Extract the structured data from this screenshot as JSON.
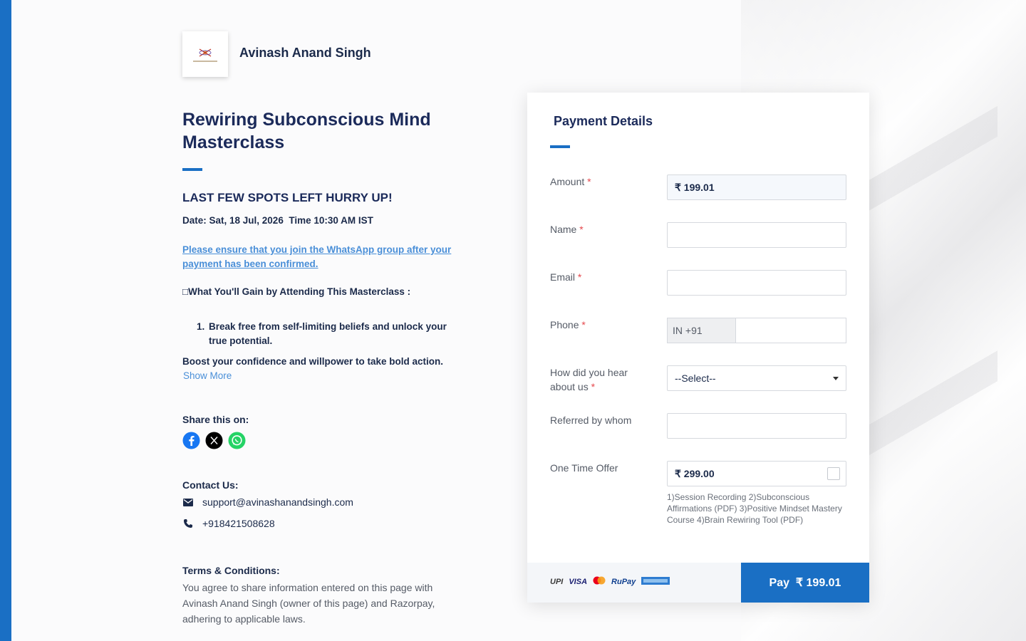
{
  "brand": {
    "name": "Avinash Anand Singh"
  },
  "page": {
    "title": "Rewiring Subconscious Mind Masterclass",
    "hurry": "LAST FEW SPOTS LEFT HURRY UP!",
    "date_line": "Date: Sat, 18 Jul, 2026  Time 10:30 AM IST",
    "whatsapp_link": "Please ensure that you join the WhatsApp group after your payment has been confirmed.",
    "gain_heading": "□What You'll Gain by Attending This Masterclass :",
    "gain_items": [
      {
        "num": "1.",
        "text": "Break free from self-limiting beliefs and unlock your true potential."
      }
    ],
    "boost": "Boost your confidence and willpower to take bold action.",
    "show_more": "Show More",
    "share_label": "Share this on:",
    "share_icons": [
      "facebook-icon",
      "x-icon",
      "whatsapp-icon"
    ],
    "contact_label": "Contact Us:",
    "contact_email": "support@avinashanandsingh.com",
    "contact_phone": "+918421508628",
    "terms_label": "Terms & Conditions:",
    "terms_text": "You agree to share information entered on this page with Avinash Anand Singh (owner of this page) and Razorpay, adhering to applicable laws."
  },
  "form": {
    "title": "Payment Details",
    "amount_label": "Amount",
    "amount_value": "₹ 199.01",
    "name_label": "Name",
    "name_value": "",
    "email_label": "Email",
    "email_value": "",
    "phone_label": "Phone",
    "phone_prefix": "IN +91",
    "phone_value": "",
    "hear_label": "How did you hear about us",
    "hear_selected": "--Select--",
    "referred_label": "Referred by whom",
    "referred_value": "",
    "offer_label": "One Time Offer",
    "offer_value": "₹ 299.00",
    "offer_checked": false,
    "offer_desc": "1)Session Recording 2)Subconscious Affirmations (PDF) 3)Positive Mindset Mastery Course 4)Brain Rewiring Tool (PDF)",
    "required_mark": "*",
    "pay_methods": [
      "UPI",
      "VISA",
      "mastercard",
      "RuPay",
      "card"
    ],
    "pay_button": "Pay  ₹ 199.01"
  },
  "colors": {
    "accent": "#1a6fc4",
    "text_dark": "#1b2a5a",
    "link": "#4a8fd8",
    "required": "#e5484d"
  }
}
